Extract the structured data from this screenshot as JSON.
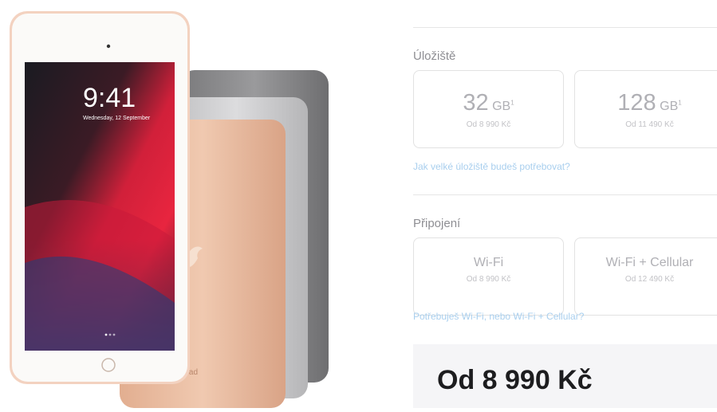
{
  "storage": {
    "title": "Úložiště",
    "options": [
      {
        "capacity": "32",
        "unit": "GB",
        "footnote": "1",
        "price": "Od 8 990 Kč"
      },
      {
        "capacity": "128",
        "unit": "GB",
        "footnote": "1",
        "price": "Od 11 490 Kč"
      }
    ],
    "help_link": "Jak velké úložiště budeš potřebovat?"
  },
  "connectivity": {
    "title": "Připojení",
    "options": [
      {
        "label": "Wi-Fi",
        "price": "Od 8 990 Kč"
      },
      {
        "label": "Wi-Fi + Cellular",
        "price": "Od 12 490 Kč"
      }
    ],
    "help_link": "Potřebuješ Wi-Fi, nebo Wi-Fi + Cellular?"
  },
  "summary": {
    "price": "Od 8 990 Kč"
  },
  "hero": {
    "time": "9:41",
    "date": "Wednesday, 12 September",
    "back_label": "iPad",
    "colors": {
      "gold": "#e8b99c",
      "silver": "#cfcfd1",
      "space_gray": "#8e8e90"
    }
  }
}
